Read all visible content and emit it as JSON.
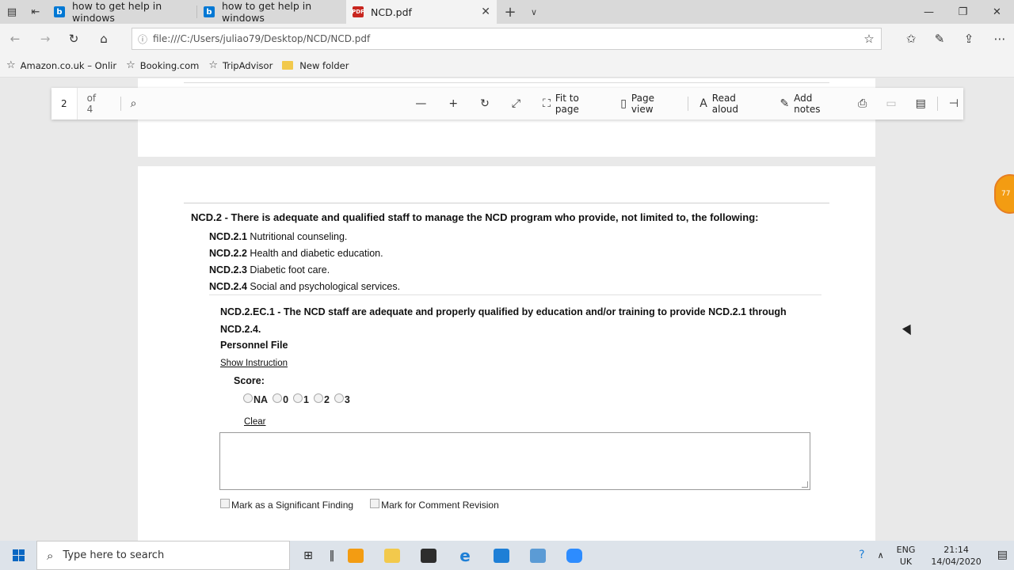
{
  "browser": {
    "tabs": [
      {
        "label": "how to get help in windows",
        "icon": "bing-icon"
      },
      {
        "label": "how to get help in windows",
        "icon": "bing-icon"
      },
      {
        "label": "NCD.pdf",
        "icon": "pdf-icon",
        "active": true
      }
    ],
    "url": "file:///C:/Users/juliao79/Desktop/NCD/NCD.pdf",
    "favorites": [
      {
        "label": "Amazon.co.uk – Onlir",
        "icon": "star-icon"
      },
      {
        "label": "Booking.com",
        "icon": "star-icon"
      },
      {
        "label": "TripAdvisor",
        "icon": "star-icon"
      },
      {
        "label": "New folder",
        "icon": "folder-icon"
      }
    ]
  },
  "pdf_toolbar": {
    "page": "2",
    "of": "of 4",
    "fit_to_page": "Fit to page",
    "page_view": "Page view",
    "read_aloud": "Read aloud",
    "add_notes": "Add notes"
  },
  "document": {
    "heading": "NCD.2 - There is adequate and qualified staff to manage the NCD program who provide, not limited to, the following:",
    "items": [
      {
        "code": "NCD.2.1",
        "text": "Nutritional counseling."
      },
      {
        "code": "NCD.2.2",
        "text": "Health and diabetic education."
      },
      {
        "code": "NCD.2.3",
        "text": "Diabetic foot care."
      },
      {
        "code": "NCD.2.4",
        "text": "Social and psychological services."
      }
    ],
    "ec_code": "NCD.2.EC.1",
    "ec_text": "The NCD staff are adequate and properly qualified by education and/or training to provide NCD.2.1 through NCD.2.4.",
    "personnel_file": "Personnel File",
    "show_instruction": "Show Instruction",
    "score_label": "Score:",
    "score_options": [
      "NA",
      "0",
      "1",
      "2",
      "3"
    ],
    "clear": "Clear",
    "mark_significant": "Mark as a Significant Finding",
    "mark_comment": "Mark for Comment Revision"
  },
  "side_badge": "77",
  "taskbar": {
    "search_placeholder": "Type here to search",
    "lang_1": "ENG",
    "lang_2": "UK",
    "time": "21:14",
    "date": "14/04/2020"
  }
}
